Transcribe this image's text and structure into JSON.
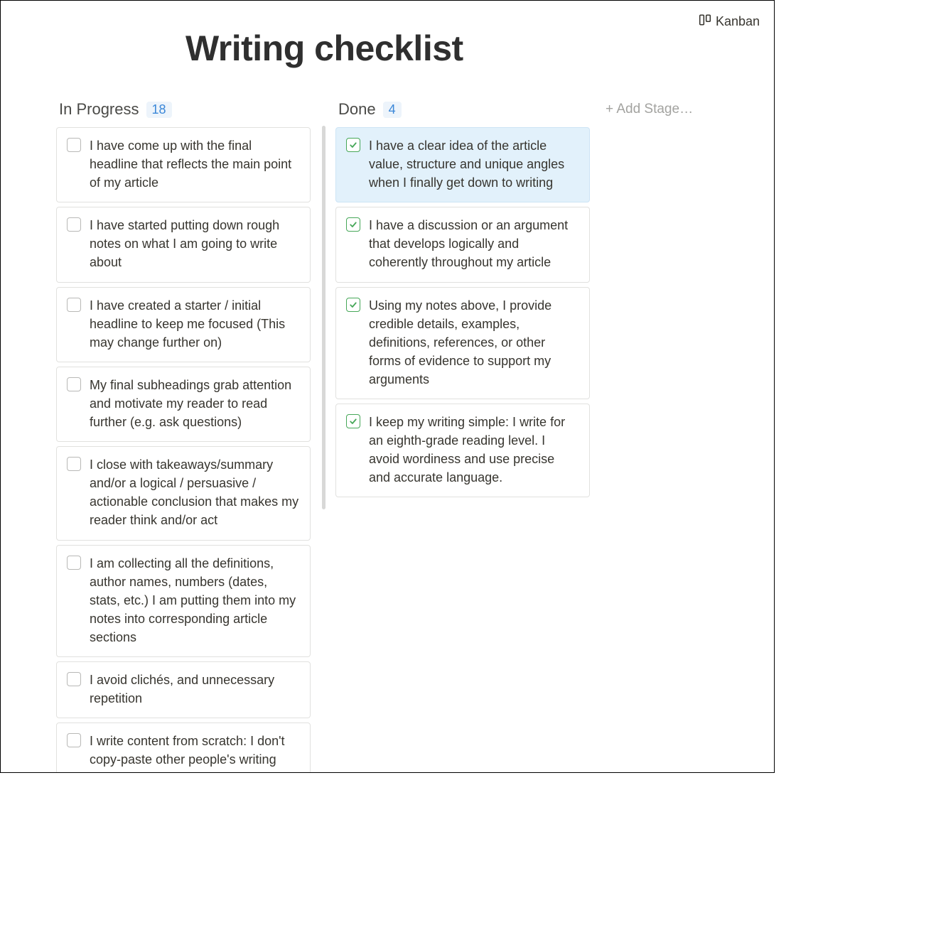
{
  "view_switch": {
    "label": "Kanban"
  },
  "page_title": "Writing checklist",
  "add_stage_label": "+ Add Stage…",
  "columns": [
    {
      "name": "In Progress",
      "count": "18",
      "cards": [
        {
          "text": "I have come up with the final headline that reflects the main point of my article",
          "checked": false,
          "highlight": false
        },
        {
          "text": "I have started putting down rough notes on what I am going to write about",
          "checked": false,
          "highlight": false
        },
        {
          "text": "I have created a starter / initial headline to keep me focused (This may change further on)",
          "checked": false,
          "highlight": false
        },
        {
          "text": "My final subheadings grab attention and motivate my reader to read further (e.g. ask questions)",
          "checked": false,
          "highlight": false
        },
        {
          "text": "I close with takeaways/summary and/or a logical / persuasive / actionable conclusion that makes my reader think and/or act",
          "checked": false,
          "highlight": false
        },
        {
          "text": "I am collecting all the definitions, author names, numbers (dates, stats, etc.) I am putting them into my notes into corresponding article sections",
          "checked": false,
          "highlight": false
        },
        {
          "text": "I avoid clichés, and unnecessary repetition",
          "checked": false,
          "highlight": false
        },
        {
          "text": "I write content from scratch: I don't copy-paste other people's writing (unless I am quoting and mentioning the author). I keep",
          "checked": false,
          "highlight": false
        }
      ]
    },
    {
      "name": "Done",
      "count": "4",
      "cards": [
        {
          "text": "I have a clear idea of the article value, structure and unique angles when I finally get down to writing",
          "checked": true,
          "highlight": true
        },
        {
          "text": "I have a discussion or an argument that develops logically and coherently throughout my article",
          "checked": true,
          "highlight": false
        },
        {
          "text": "Using my notes above, I provide credible details, examples, definitions, references, or other forms of evidence to support my arguments",
          "checked": true,
          "highlight": false
        },
        {
          "text": "I keep my writing simple: I write for an eighth-grade reading level. I avoid wordiness and use precise and accurate language.",
          "checked": true,
          "highlight": false
        }
      ]
    }
  ]
}
